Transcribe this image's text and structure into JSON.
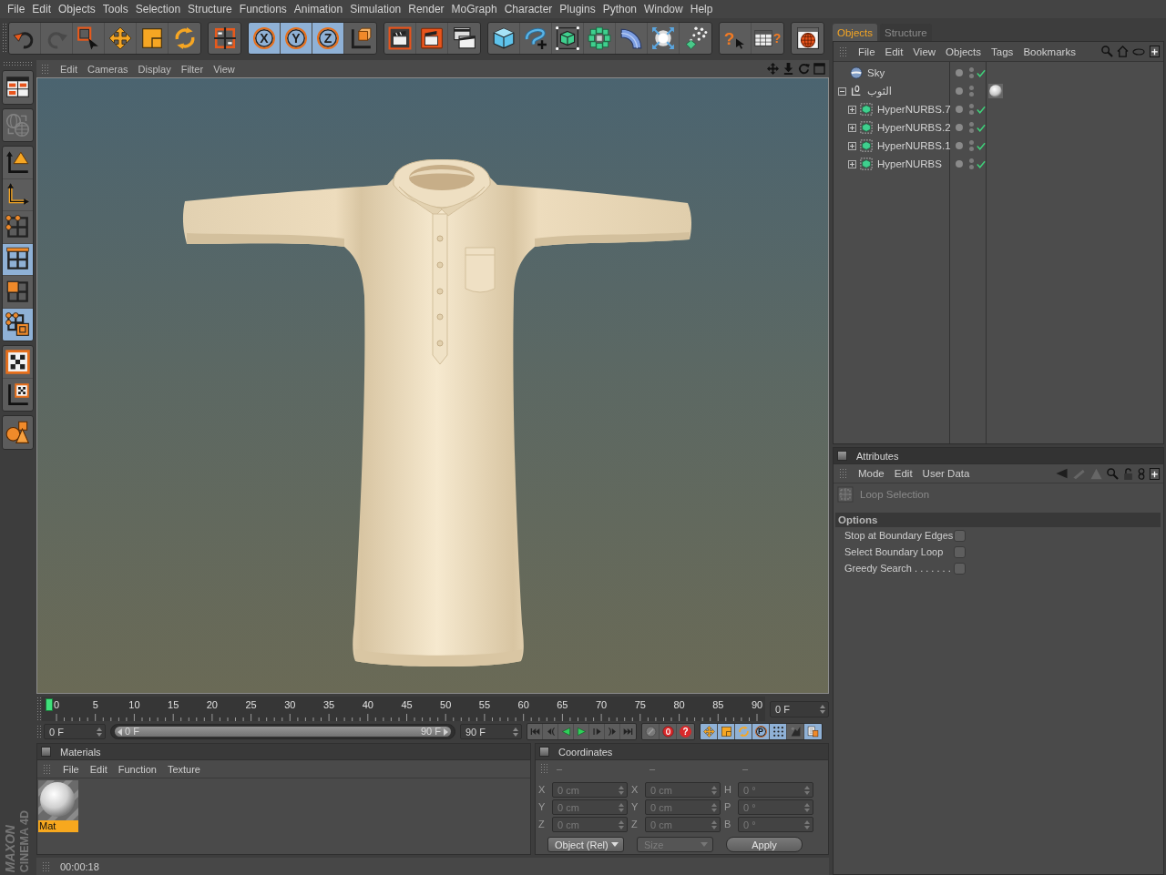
{
  "menu_bar": {
    "items": [
      "File",
      "Edit",
      "Objects",
      "Tools",
      "Selection",
      "Structure",
      "Functions",
      "Animation",
      "Simulation",
      "Render",
      "MoGraph",
      "Character",
      "Plugins",
      "Python",
      "Window",
      "Help"
    ]
  },
  "toolbar": {
    "groups": [
      {
        "items": [
          {
            "kind": "undo",
            "selected": false,
            "disabled": false
          },
          {
            "kind": "redo",
            "selected": false,
            "disabled": true
          },
          {
            "kind": "select",
            "selected": false,
            "disabled": false
          },
          {
            "kind": "move",
            "selected": false,
            "disabled": false
          },
          {
            "kind": "scale",
            "selected": false,
            "disabled": false
          },
          {
            "kind": "rotate",
            "selected": false,
            "disabled": false
          }
        ]
      },
      {
        "items": [
          {
            "kind": "coords",
            "selected": false,
            "disabled": false
          }
        ]
      },
      {
        "items": [
          {
            "kind": "axis",
            "label": "X",
            "selected": true,
            "disabled": false
          },
          {
            "kind": "axis",
            "label": "Y",
            "selected": true,
            "disabled": false
          },
          {
            "kind": "axis",
            "label": "Z",
            "selected": true,
            "disabled": false
          },
          {
            "kind": "world",
            "selected": false,
            "disabled": false
          }
        ]
      },
      {
        "items": [
          {
            "kind": "renderview",
            "selected": false,
            "disabled": false
          },
          {
            "kind": "renderpicture",
            "selected": false,
            "disabled": false
          },
          {
            "kind": "rendersettings",
            "selected": false,
            "disabled": false
          }
        ]
      },
      {
        "items": [
          {
            "kind": "cube",
            "selected": false,
            "disabled": false
          },
          {
            "kind": "spline",
            "selected": false,
            "disabled": false
          },
          {
            "kind": "nurbs",
            "selected": false,
            "disabled": false
          },
          {
            "kind": "array",
            "selected": false,
            "disabled": false
          },
          {
            "kind": "deformer",
            "selected": false,
            "disabled": false
          },
          {
            "kind": "scene",
            "selected": false,
            "disabled": false
          },
          {
            "kind": "particles",
            "selected": false,
            "disabled": false
          }
        ]
      },
      {
        "items": [
          {
            "kind": "help",
            "label": "?",
            "selected": false,
            "disabled": false
          },
          {
            "kind": "helptable",
            "label": "?",
            "selected": false,
            "disabled": false
          }
        ]
      },
      {
        "items": [
          {
            "kind": "browser",
            "selected": false,
            "disabled": false
          }
        ]
      }
    ]
  },
  "left_toolbar": {
    "groups": [
      {
        "items": [
          {
            "kind": "layout",
            "selected": false,
            "disabled": false
          }
        ]
      },
      {
        "items": [
          {
            "kind": "mesh",
            "selected": false,
            "disabled": true
          }
        ]
      },
      {
        "items": [
          {
            "kind": "editable",
            "selected": false,
            "disabled": false
          },
          {
            "kind": "objaxis",
            "selected": false,
            "disabled": false
          },
          {
            "kind": "points",
            "selected": false,
            "disabled": false
          },
          {
            "kind": "edges",
            "selected": true,
            "disabled": false
          },
          {
            "kind": "polygons",
            "selected": false,
            "disabled": false
          },
          {
            "kind": "model",
            "selected": true,
            "disabled": false
          }
        ]
      },
      {
        "items": [
          {
            "kind": "texture",
            "selected": false,
            "disabled": false
          },
          {
            "kind": "textureaxis",
            "selected": false,
            "disabled": false
          }
        ]
      },
      {
        "items": [
          {
            "kind": "workplane",
            "selected": false,
            "disabled": false
          }
        ]
      }
    ]
  },
  "viewport": {
    "menu": [
      "Edit",
      "Cameras",
      "Display",
      "Filter",
      "View"
    ]
  },
  "timeline": {
    "labels": [
      "0",
      "5",
      "10",
      "15",
      "20",
      "25",
      "30",
      "35",
      "40",
      "45",
      "50",
      "55",
      "60",
      "65",
      "70",
      "75",
      "80",
      "85",
      "90"
    ],
    "playhead": {
      "level": 0
    },
    "frame_field": "0 F"
  },
  "transport": {
    "start_field": "0 F",
    "range": {
      "start": "0 F",
      "end": "90 F",
      "level": 1
    },
    "end_field": "90 F",
    "record": [
      {
        "kind": "autokey"
      },
      {
        "kind": "record"
      },
      {
        "kind": "keyselection",
        "label": "?"
      }
    ],
    "keys": [
      {
        "kind": "move",
        "selected": true
      },
      {
        "kind": "scale",
        "selected": true
      },
      {
        "kind": "rotate",
        "selected": true
      },
      {
        "kind": "param",
        "label": "P",
        "selected": true
      },
      {
        "kind": "points",
        "selected": true
      },
      {
        "kind": "morph",
        "selected": false
      },
      {
        "kind": "scheme",
        "selected": true
      }
    ]
  },
  "objects_manager": {
    "tabs": [
      {
        "label": "Objects",
        "selected": true
      },
      {
        "label": "Structure",
        "selected": false
      }
    ],
    "menu": [
      "File",
      "Edit",
      "View",
      "Objects",
      "Tags",
      "Bookmarks"
    ],
    "tree": [
      {
        "name": "Sky",
        "kind": "sky",
        "checked": true
      },
      {
        "name": "الثوب",
        "kind": "null",
        "expanded": true,
        "checked": false,
        "tags": [
          {
            "kind": "material"
          }
        ],
        "children": [
          {
            "name": "HyperNURBS.7",
            "kind": "hypernurbs",
            "expanded": false,
            "checked": true
          },
          {
            "name": "HyperNURBS.2",
            "kind": "hypernurbs",
            "expanded": false,
            "checked": true
          },
          {
            "name": "HyperNURBS.1",
            "kind": "hypernurbs",
            "expanded": false,
            "checked": true
          },
          {
            "name": "HyperNURBS",
            "kind": "hypernurbs",
            "expanded": false,
            "checked": true
          }
        ]
      }
    ]
  },
  "attributes": {
    "title": "Attributes",
    "menu": [
      "Mode",
      "Edit",
      "User Data"
    ],
    "nav": [
      {
        "kind": "back",
        "disabled": false
      },
      {
        "kind": "forward",
        "disabled": true
      },
      {
        "kind": "up",
        "disabled": true
      }
    ],
    "tool": "Loop Selection",
    "section": "Options",
    "options": [
      {
        "label": "Stop at Boundary Edges",
        "checked": false
      },
      {
        "label": "Select Boundary Loop",
        "checked": false
      },
      {
        "label": "Greedy Search . . . . . . .",
        "checked": false
      }
    ]
  },
  "materials": {
    "title": "Materials",
    "menu": [
      "File",
      "Edit",
      "Function",
      "Texture"
    ],
    "items": [
      {
        "name": "Mat",
        "selected": true
      }
    ]
  },
  "coordinates": {
    "title": "Coordinates",
    "columns": [
      "–",
      "–",
      "–"
    ],
    "disabled": true,
    "rows": [
      {
        "position_axis": "X",
        "position": "0 cm",
        "size_axis": "X",
        "size": "0 cm",
        "rotation_axis": "H",
        "rotation": "0 °"
      },
      {
        "position_axis": "Y",
        "position": "0 cm",
        "size_axis": "Y",
        "size": "0 cm",
        "rotation_axis": "P",
        "rotation": "0 °"
      },
      {
        "position_axis": "Z",
        "position": "0 cm",
        "size_axis": "Z",
        "size": "0 cm",
        "rotation_axis": "B",
        "rotation": "0 °"
      }
    ],
    "mode": "Object (Rel)",
    "size_mode": {
      "label": "Size",
      "disabled": true
    },
    "apply": "Apply"
  },
  "status_bar": {
    "time": "00:00:18"
  },
  "logo": {
    "brand": "MAXON",
    "product": "CINEMA 4D"
  }
}
